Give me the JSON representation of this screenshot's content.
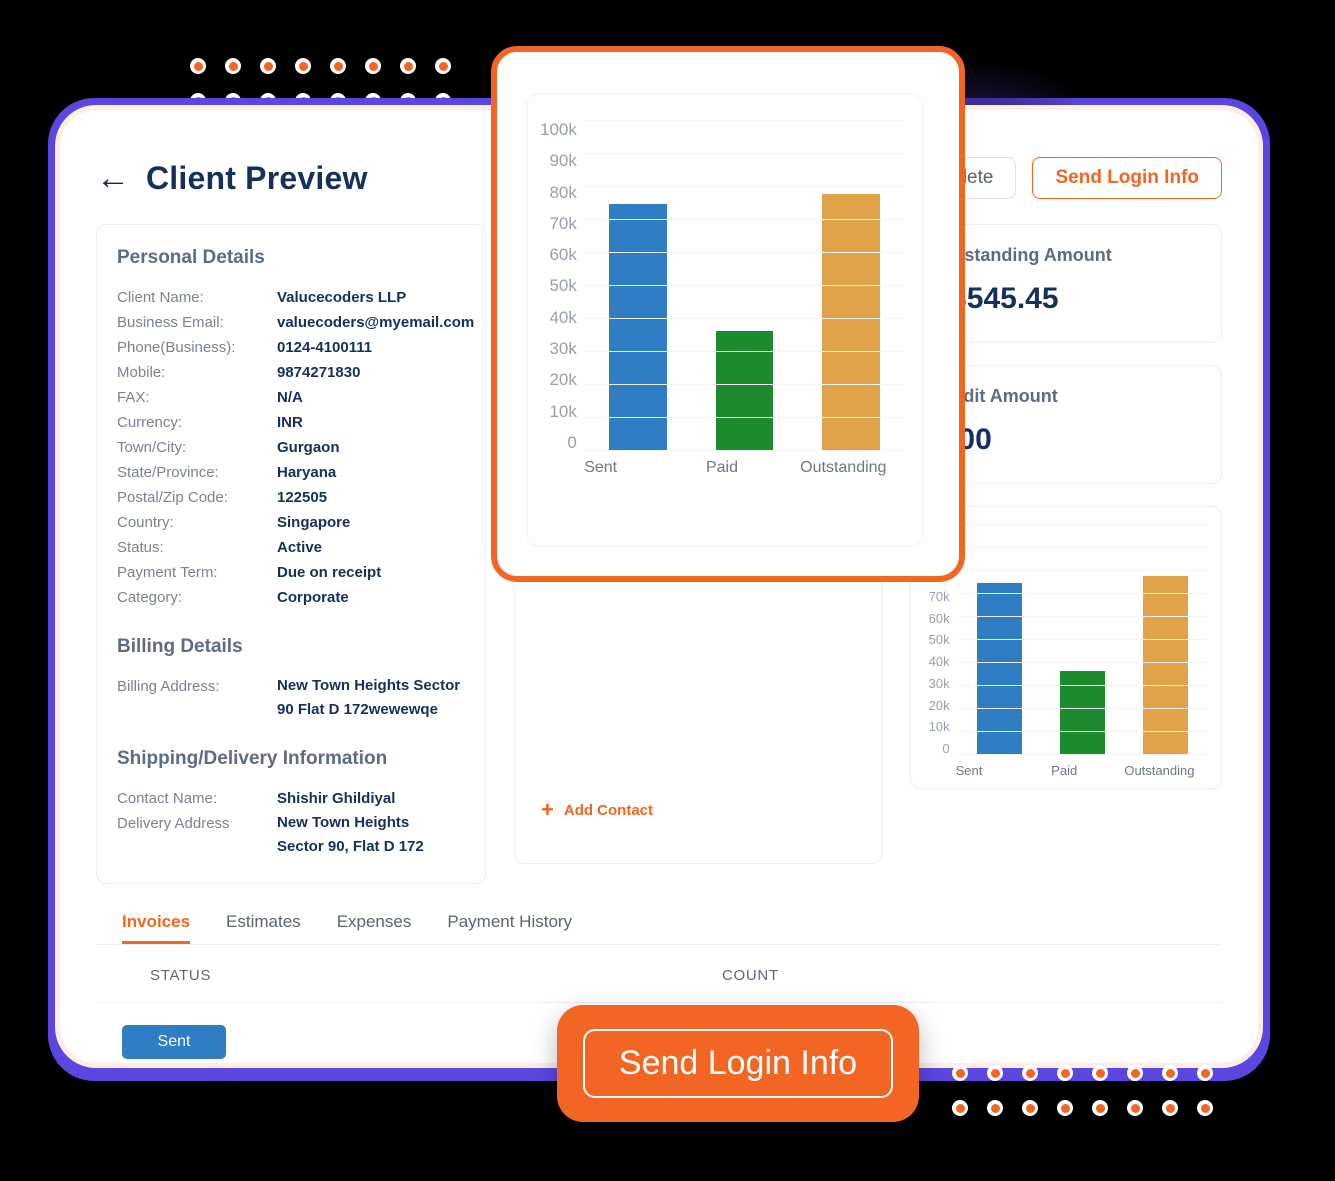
{
  "header": {
    "back_icon": "left-arrow-icon",
    "title": "Client Preview",
    "actions": [
      {
        "label": "Delete",
        "style": "grey"
      },
      {
        "label": "Send Login Info",
        "style": "orange"
      }
    ]
  },
  "personal_details": {
    "section_title": "Personal Details",
    "rows": [
      {
        "label": "Client Name:",
        "value": "Valucecoders LLP"
      },
      {
        "label": "Business Email:",
        "value": "valuecoders@myemail.com"
      },
      {
        "label": "Phone(Business):",
        "value": "0124-4100111"
      },
      {
        "label": "Mobile:",
        "value": "9874271830"
      },
      {
        "label": "FAX:",
        "value": "N/A"
      },
      {
        "label": "Currency:",
        "value": "INR"
      },
      {
        "label": "Town/City:",
        "value": "Gurgaon"
      },
      {
        "label": "State/Province:",
        "value": "Haryana"
      },
      {
        "label": "Postal/Zip Code:",
        "value": "122505"
      },
      {
        "label": "Country:",
        "value": "Singapore"
      },
      {
        "label": "Status:",
        "value": "Active"
      },
      {
        "label": "Payment Term:",
        "value": "Due on receipt"
      },
      {
        "label": "Category:",
        "value": "Corporate"
      }
    ]
  },
  "billing_details": {
    "section_title": "Billing Details",
    "rows": [
      {
        "label": "Billing Address:",
        "value": "New Town Heights Sector\n90 Flat D 172wewewqe"
      }
    ]
  },
  "shipping_details": {
    "section_title": "Shipping/Delivery Information",
    "rows": [
      {
        "label": "Contact Name:",
        "value": "Shishir Ghildiyal"
      },
      {
        "label": "Delivery Address",
        "value": "New Town Heights\nSector 90, Flat D 172"
      }
    ]
  },
  "contacts_panel": {
    "add_contact_label": "Add Contact",
    "add_contact_icon": "plus-icon"
  },
  "amounts": [
    {
      "label": "Outstanding Amount",
      "value": "13545.45"
    },
    {
      "label": "Credit Amount",
      "value": "0.00"
    }
  ],
  "tabs": [
    {
      "label": "Invoices",
      "active": true
    },
    {
      "label": "Estimates",
      "active": false
    },
    {
      "label": "Expenses",
      "active": false
    },
    {
      "label": "Payment History",
      "active": false
    }
  ],
  "table": {
    "columns": [
      "STATUS",
      "COUNT"
    ],
    "rows": [
      {
        "status": "Sent",
        "count": ""
      }
    ]
  },
  "cta": {
    "label": "Send Login Info"
  },
  "colors": {
    "accent_orange": "#F26522",
    "frame_purple": "#5B47E0",
    "title_navy": "#14305B",
    "bar_sent": "#2F7DC2",
    "bar_paid": "#1E8A2E",
    "bar_outstanding": "#E2A348"
  },
  "chart_data": {
    "type": "bar",
    "title": "",
    "xlabel": "",
    "ylabel": "",
    "categories": [
      "Sent",
      "Paid",
      "Outstanding"
    ],
    "values": [
      75000,
      36500,
      78000
    ],
    "colors": [
      "#2F7DC2",
      "#1E8A2E",
      "#E2A348"
    ],
    "ylim": [
      0,
      100000
    ],
    "yticks": [
      100000,
      90000,
      80000,
      70000,
      60000,
      50000,
      40000,
      30000,
      20000,
      10000,
      0
    ],
    "ytick_labels": [
      "100k",
      "90k",
      "80k",
      "70k",
      "60k",
      "50k",
      "40k",
      "30k",
      "20k",
      "10k",
      "0"
    ],
    "grid": true,
    "legend": "none"
  }
}
